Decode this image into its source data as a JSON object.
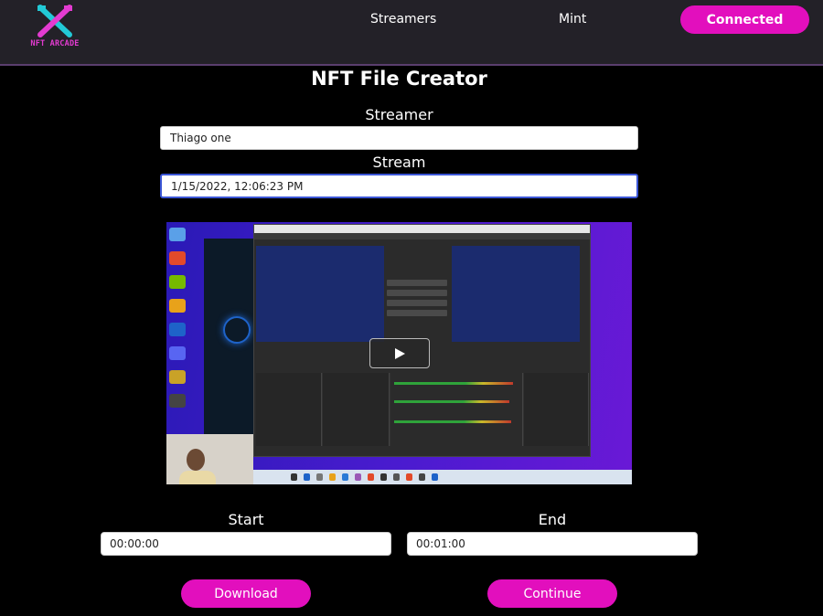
{
  "brand": {
    "name": "NFT ARCADE",
    "accent": "#e20fbd"
  },
  "nav": {
    "streamers": "Streamers",
    "mint": "Mint",
    "connected": "Connected"
  },
  "page": {
    "title": "NFT File Creator"
  },
  "form": {
    "streamer_label": "Streamer",
    "streamer_value": "Thiago one",
    "stream_label": "Stream",
    "stream_value": "1/15/2022, 12:06:23 PM",
    "start_label": "Start",
    "start_value": "00:00:00",
    "end_label": "End",
    "end_value": "00:01:00"
  },
  "video": {
    "play_icon": "play-icon"
  },
  "actions": {
    "download": "Download",
    "continue": "Continue"
  }
}
